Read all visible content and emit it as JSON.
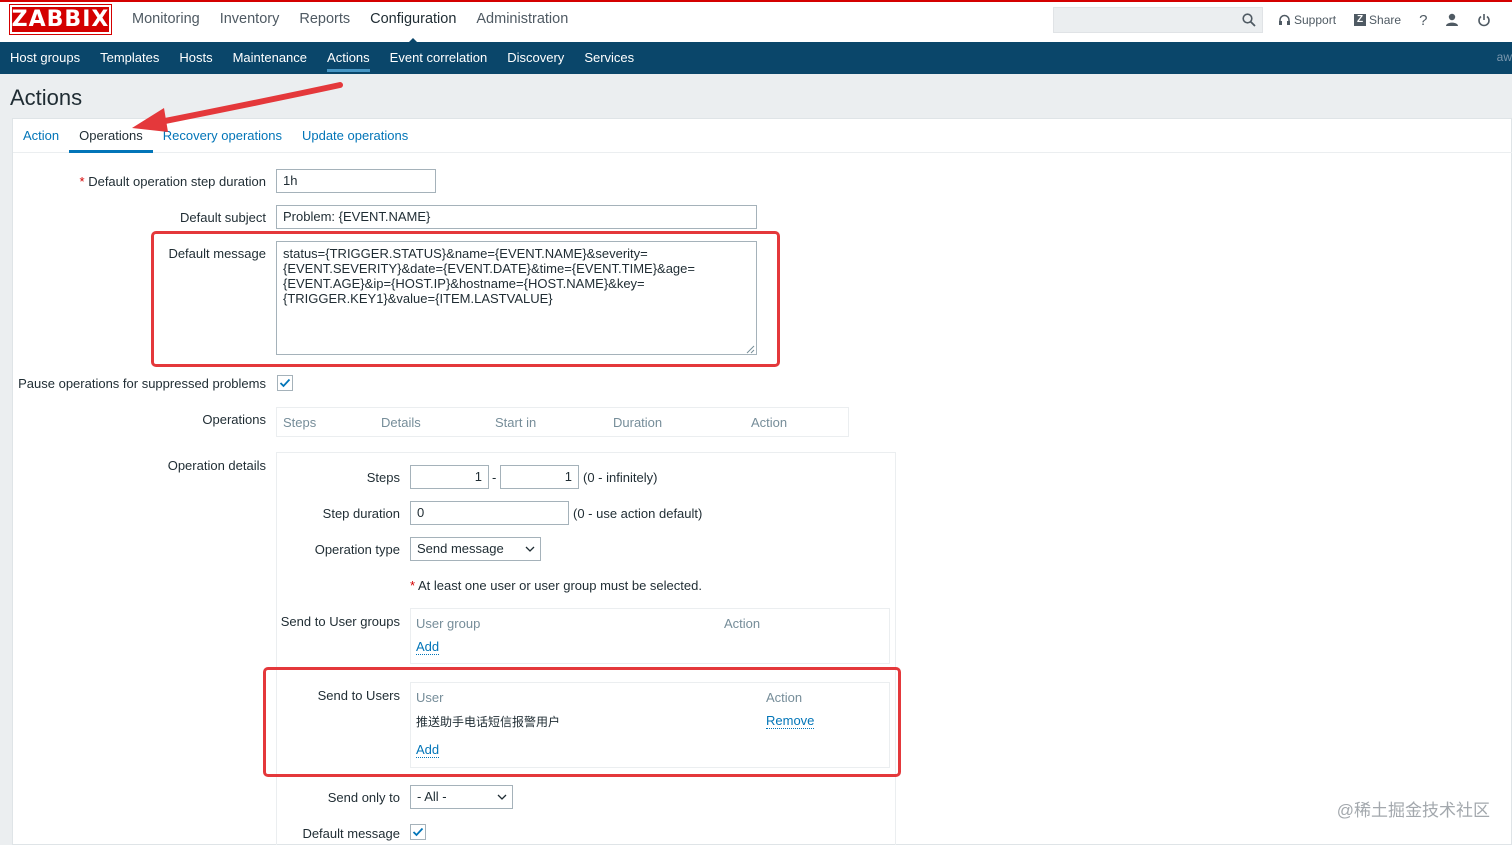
{
  "header": {
    "logo": "ZABBIX",
    "main_menu": [
      "Monitoring",
      "Inventory",
      "Reports",
      "Configuration",
      "Administration"
    ],
    "active_menu": "Configuration",
    "support_label": "Support",
    "share_label": "Share",
    "share_badge": "Z",
    "help_label": "?"
  },
  "subnav": {
    "items": [
      "Host groups",
      "Templates",
      "Hosts",
      "Maintenance",
      "Actions",
      "Event correlation",
      "Discovery",
      "Services"
    ],
    "active": "Actions",
    "right_text": "aw"
  },
  "page_title": "Actions",
  "tabs": [
    "Action",
    "Operations",
    "Recovery operations",
    "Update operations"
  ],
  "active_tab": "Operations",
  "form": {
    "step_duration_label": "Default operation step duration",
    "step_duration_value": "1h",
    "subject_label": "Default subject",
    "subject_value": "Problem: {EVENT.NAME}",
    "message_label": "Default message",
    "message_value": "status={TRIGGER.STATUS}&name={EVENT.NAME}&severity=\n{EVENT.SEVERITY}&date={EVENT.DATE}&time={EVENT.TIME}&age=\n{EVENT.AGE}&ip={HOST.IP}&hostname={HOST.NAME}&key=\n{TRIGGER.KEY1}&value={ITEM.LASTVALUE}",
    "pause_label": "Pause operations for suppressed problems",
    "pause_checked": true,
    "operations_label": "Operations",
    "operations_columns": [
      "Steps",
      "Details",
      "Start in",
      "Duration",
      "Action"
    ]
  },
  "operation_details": {
    "label": "Operation details",
    "steps_label": "Steps",
    "steps_from": "1",
    "steps_sep": "-",
    "steps_to": "1",
    "steps_hint": "(0 - infinitely)",
    "step_duration_label": "Step duration",
    "step_duration_value": "0",
    "step_duration_hint": "(0 - use action default)",
    "operation_type_label": "Operation type",
    "operation_type_value": "Send message",
    "required_note": "At least one user or user group must be selected.",
    "user_groups_label": "Send to User groups",
    "user_groups_columns": [
      "User group",
      "Action"
    ],
    "user_groups_add": "Add",
    "users_label": "Send to Users",
    "users_columns": [
      "User",
      "Action"
    ],
    "users": [
      {
        "name": "推送助手电话短信报警用户",
        "action": "Remove"
      }
    ],
    "users_add": "Add",
    "send_only_label": "Send only to",
    "send_only_value": "- All -",
    "default_message_label": "Default message",
    "default_message_checked": true
  },
  "watermark": "@稀土掘金技术社区",
  "annotation_color": "#e4383b"
}
